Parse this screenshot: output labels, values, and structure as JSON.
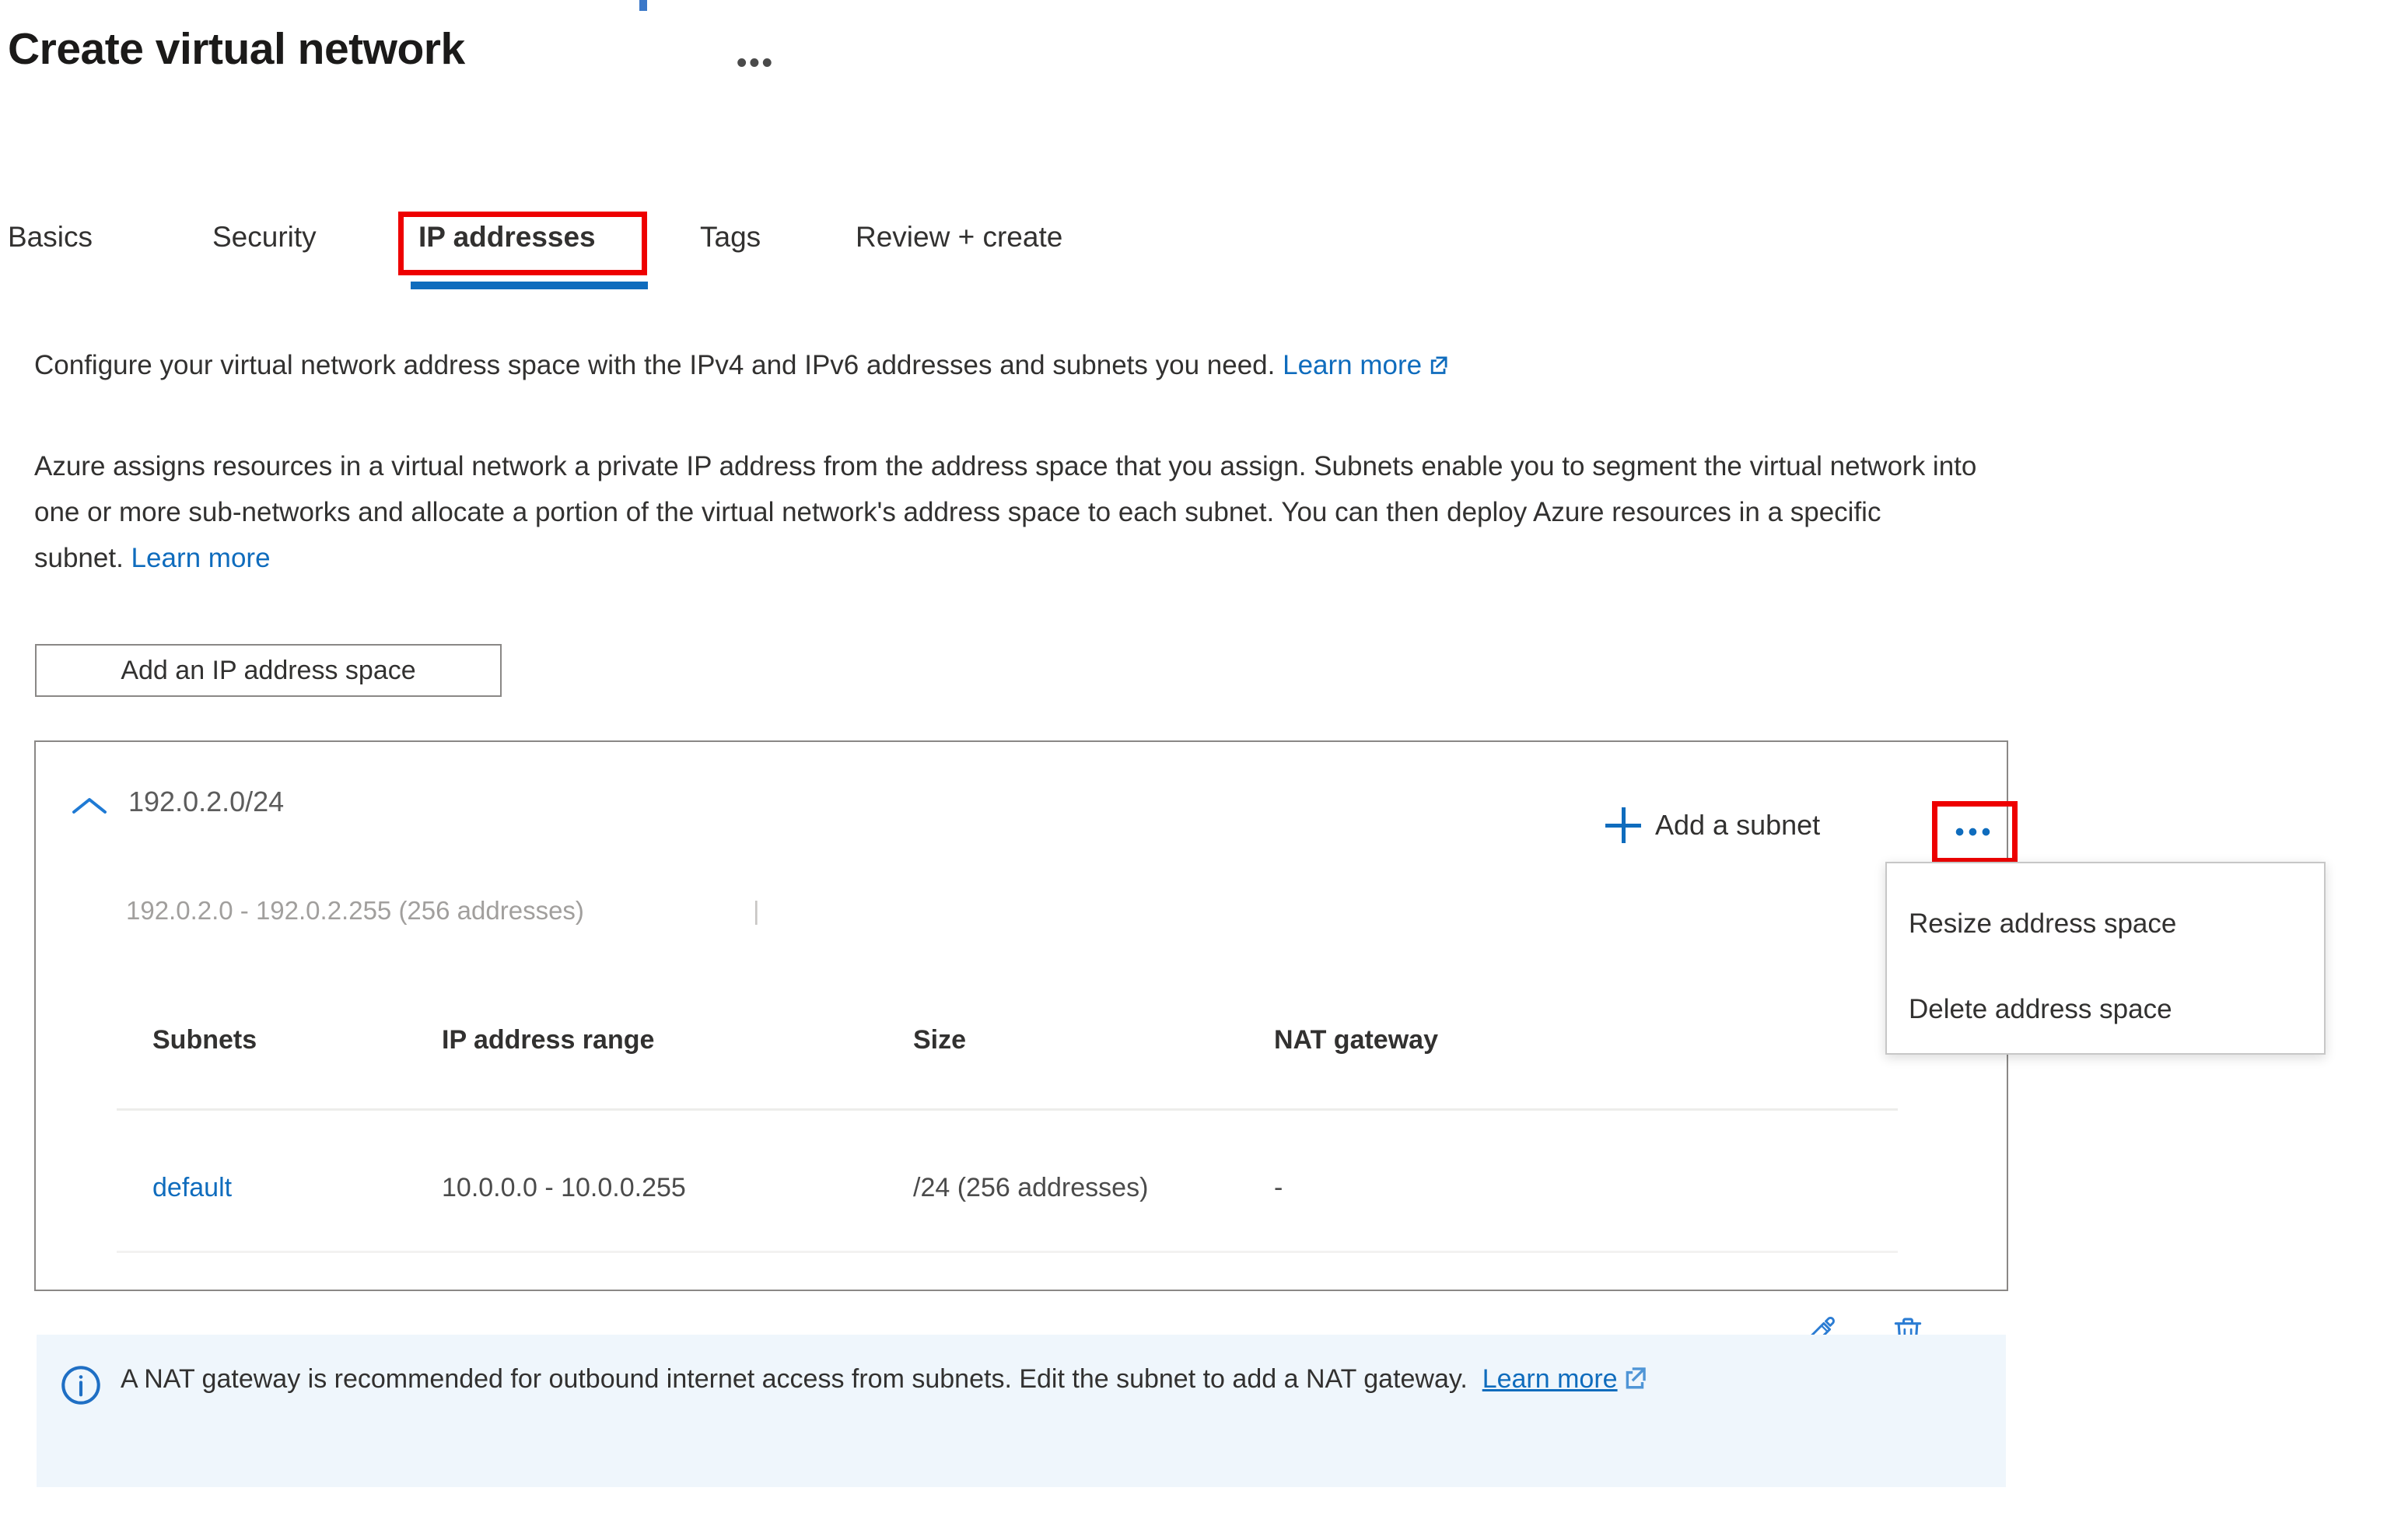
{
  "header": {
    "title": "Create virtual network",
    "more_menu": "•••",
    "more_menu_icon": "ellipsis-horizontal-icon"
  },
  "tabs": [
    {
      "label": "Basics",
      "selected": false
    },
    {
      "label": "Security",
      "selected": false
    },
    {
      "label": "IP addresses",
      "selected": true
    },
    {
      "label": "Tags",
      "selected": false
    },
    {
      "label": "Review + create",
      "selected": false
    }
  ],
  "description": {
    "line1_before": "Configure your virtual network address space with the IPv4 and IPv6 addresses and subnets you need. ",
    "line1_link": "Learn more",
    "line1_link_icon": "external-link-icon",
    "line2_before": "Azure assigns resources in a virtual network a private IP address from the address space that you assign. Subnets enable you to segment the virtual network into one or more sub-networks and allocate a portion of the virtual network's address space to each subnet. You can then deploy Azure resources in a specific subnet. ",
    "line2_link": "Learn more"
  },
  "toolbar": {
    "add_ip_space_label": "Add an IP address space"
  },
  "address_space": {
    "collapse_icon": "chevron-up-icon",
    "cidr": "192.0.2.0/24",
    "range_text": "192.0.2.0 - 192.0.2.255 (256 addresses)",
    "range_text_tail": "|",
    "add_subnet_label": "Add a subnet",
    "add_subnet_icon": "plus-icon",
    "more_button_icon": "ellipsis-horizontal-icon",
    "more_button_label": "•••"
  },
  "context_menu": {
    "items": [
      {
        "label": "Resize address space",
        "highlighted": false
      },
      {
        "label": "Delete address space",
        "highlighted": true
      }
    ]
  },
  "subnets_table": {
    "columns": [
      "Subnets",
      "IP address range",
      "Size",
      "NAT gateway"
    ],
    "rows": [
      {
        "name": "default",
        "ip_address_range": "10.0.0.0 - 10.0.0.255",
        "size": "/24 (256 addresses)",
        "nat_gateway": "-",
        "edit_icon": "pencil-icon",
        "delete_icon": "trash-icon"
      }
    ]
  },
  "nat_banner": {
    "icon": "info-circle-icon",
    "text_before": "A NAT gateway is recommended for outbound internet access from subnets. Edit the subnet to add a NAT gateway.  ",
    "link": "Learn more",
    "link_icon": "external-link-icon"
  },
  "annotations": {
    "highlight_color": "#ee0000",
    "boxes": [
      "tab-ip-addresses",
      "address-space-more-button",
      "menu-item-delete-address-space"
    ]
  },
  "colors": {
    "accent_blue": "#0f6cbd",
    "banner_bg": "#eff6fc",
    "panel_border": "#8a8886",
    "text": "#323130",
    "muted": "#a19f9d",
    "highlight_red": "#ee0000"
  }
}
